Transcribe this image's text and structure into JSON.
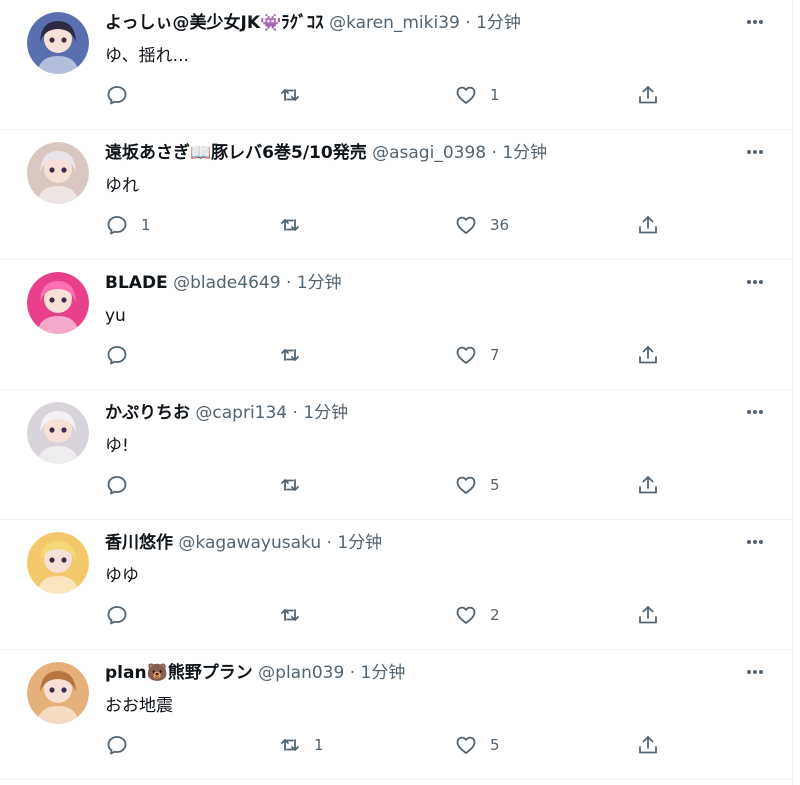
{
  "tweets": [
    {
      "name": "よっしぃ@美少女JK👾ﾗｸﾞｺｽ",
      "handle": "@karen_miki39",
      "dot": "·",
      "time": "1分钟",
      "text": "ゆ、揺れ...",
      "replies": "",
      "retweets": "",
      "likes": "1",
      "avatar_color": "#5a6fb0"
    },
    {
      "name": "遠坂あさぎ📖豚レバ6巻5/10発売",
      "handle": "@asagi_0398",
      "dot": "·",
      "time": "1分钟",
      "text": "ゆれ",
      "replies": "1",
      "retweets": "",
      "likes": "36",
      "avatar_color": "#d8c6c0"
    },
    {
      "name": "BLADE",
      "handle": "@blade4649",
      "dot": "·",
      "time": "1分钟",
      "text": "yu",
      "replies": "",
      "retweets": "",
      "likes": "7",
      "avatar_color": "#e8408a"
    },
    {
      "name": "かぷりちお",
      "handle": "@capri134",
      "dot": "·",
      "time": "1分钟",
      "text": "ゆ!",
      "replies": "",
      "retweets": "",
      "likes": "5",
      "avatar_color": "#d9d4dc"
    },
    {
      "name": "香川悠作",
      "handle": "@kagawayusaku",
      "dot": "·",
      "time": "1分钟",
      "text": "ゆゆ",
      "replies": "",
      "retweets": "",
      "likes": "2",
      "avatar_color": "#f2c86a"
    },
    {
      "name": "plan🐻熊野プラン",
      "handle": "@plan039",
      "dot": "·",
      "time": "1分钟",
      "text": "おお地震",
      "replies": "",
      "retweets": "1",
      "likes": "5",
      "avatar_color": "#e6b07a"
    }
  ],
  "icons": {
    "more": "more-horizontal-icon",
    "reply": "reply-icon",
    "retweet": "retweet-icon",
    "like": "heart-icon",
    "share": "share-icon"
  },
  "colors": {
    "text": "#0f1419",
    "secondary": "#536471",
    "divider": "#eff3f4"
  }
}
